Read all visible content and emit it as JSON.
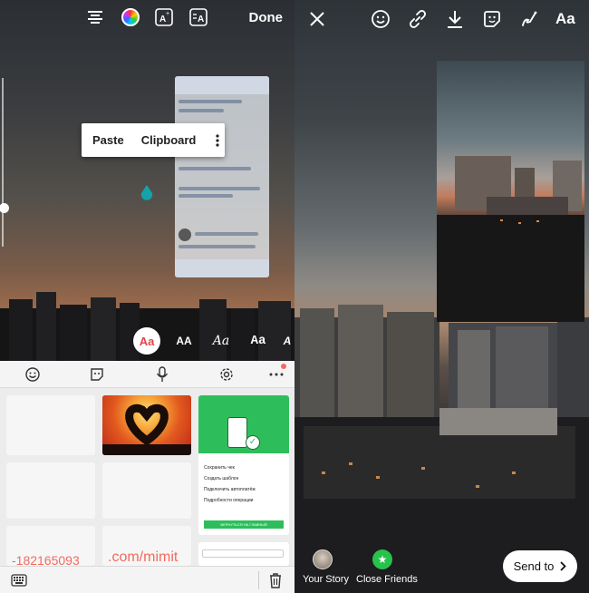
{
  "left": {
    "toolbar": {
      "done_label": "Done"
    },
    "popup": {
      "paste_label": "Paste",
      "clipboard_label": "Clipboard"
    },
    "text_styles": [
      {
        "label": "Aa",
        "active": true
      },
      {
        "label": "AA",
        "active": false
      },
      {
        "label": "Aa",
        "active": false
      },
      {
        "label": "Aa",
        "active": false
      },
      {
        "label": "A",
        "active": false
      }
    ],
    "keyboard": {
      "clip_items": [
        {
          "text": "-182165093"
        },
        {
          "text": ".com/mimit"
        }
      ],
      "thumb_texts": [
        "Сохранить чек",
        "Создать шаблон",
        "Подключить автоплатёж",
        "Подробности операции",
        "ВЕРНУТЬСЯ НА ГЛАВНЫЙ"
      ]
    }
  },
  "right": {
    "toolbar": {
      "text_label": "Aa"
    },
    "bottom": {
      "your_story": "Your Story",
      "close_friends": "Close Friends",
      "send_to": "Send to"
    }
  },
  "colors": {
    "accent_red": "#e2454b",
    "clip_text": "#f16b5f",
    "close_friends_green": "#27c24c",
    "app_green": "#2dbe5b"
  }
}
